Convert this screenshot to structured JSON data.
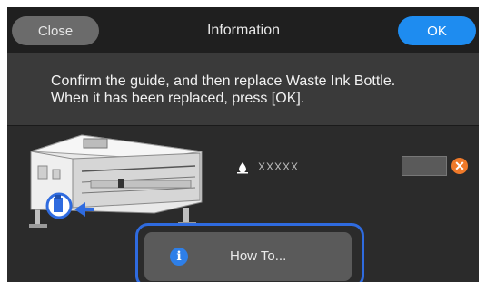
{
  "header": {
    "close_label": "Close",
    "title": "Information",
    "ok_label": "OK"
  },
  "message": {
    "line1": "Confirm the guide, and then replace Waste Ink Bottle.",
    "line2": "When it has been replaced, press [OK]."
  },
  "status": {
    "ink_label": "XXXXX",
    "waste_ink_level": 0.9
  },
  "actions": {
    "how_to_label": "How To..."
  },
  "colors": {
    "accent": "#1e8cf0",
    "focus": "#2f6bdf",
    "error": "#f07a2a",
    "header_bg": "#1f1f1f",
    "message_bg": "#3a3a3a",
    "body_bg": "#2b2b2b"
  },
  "icons": [
    "printer-illustration",
    "ink-drop-icon",
    "error-x-icon",
    "info-icon",
    "arrow-left-icon"
  ]
}
